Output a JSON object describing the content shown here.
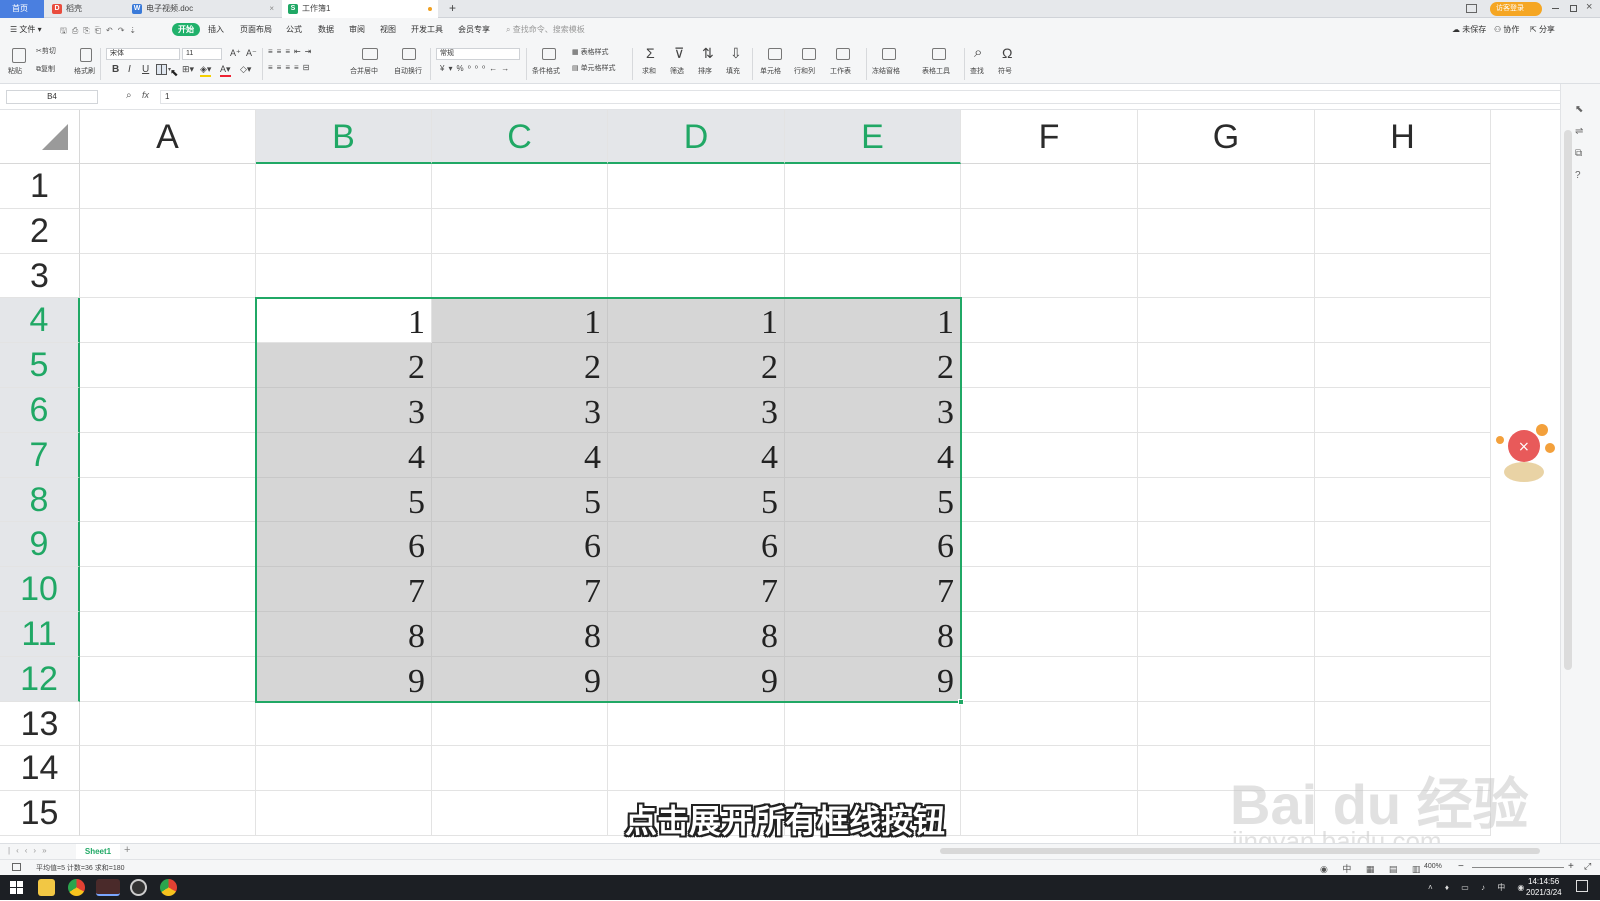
{
  "tabs": [
    {
      "label": "首页",
      "active": true
    },
    {
      "label": "稻壳"
    },
    {
      "label": "电子视频.doc"
    },
    {
      "label": "工作簿1"
    }
  ],
  "tabbar_right": {
    "login_label": "访客登录"
  },
  "menu": {
    "file": "文件",
    "items": [
      "开始",
      "插入",
      "页面布局",
      "公式",
      "数据",
      "审阅",
      "视图",
      "开发工具",
      "会员专享"
    ],
    "search_placeholder": "查找命令、搜索模板",
    "right": [
      "未保存",
      "协作",
      "分享"
    ]
  },
  "ribbon": {
    "paste": "粘贴",
    "cut": "剪切",
    "copy": "复制",
    "format_painter": "格式刷",
    "font_name": "宋体",
    "font_size": "11",
    "bold": "B",
    "italic": "I",
    "underline": "U",
    "merge": "合并居中",
    "wrap": "自动换行",
    "number_format": "常规",
    "cond_format": "条件格式",
    "table_style": "表格样式",
    "cell_style": "单元格样式",
    "sum": "求和",
    "filter": "筛选",
    "sort": "排序",
    "fill": "填充",
    "cell": "单元格",
    "rowcol": "行和列",
    "sheet": "工作表",
    "freeze": "冻结窗格",
    "table_tools": "表格工具",
    "find": "查找",
    "symbol": "符号"
  },
  "formula_bar": {
    "cell_ref": "B4",
    "fx": "fx",
    "value": "1"
  },
  "columns": [
    "A",
    "B",
    "C",
    "D",
    "E",
    "F",
    "G",
    "H"
  ],
  "rows": [
    "1",
    "2",
    "3",
    "4",
    "5",
    "6",
    "7",
    "8",
    "9",
    "10",
    "11",
    "12",
    "13",
    "14",
    "15"
  ],
  "cells": {
    "B4": "1",
    "C4": "1",
    "D4": "1",
    "E4": "1",
    "B5": "2",
    "C5": "2",
    "D5": "2",
    "E5": "2",
    "B6": "3",
    "C6": "3",
    "D6": "3",
    "E6": "3",
    "B7": "4",
    "C7": "4",
    "D7": "4",
    "E7": "4",
    "B8": "5",
    "C8": "5",
    "D8": "5",
    "E8": "5",
    "B9": "6",
    "C9": "6",
    "D9": "6",
    "E9": "6",
    "B10": "7",
    "C10": "7",
    "D10": "7",
    "E10": "7",
    "B11": "8",
    "C11": "8",
    "D11": "8",
    "E11": "8",
    "B12": "9",
    "C12": "9",
    "D12": "9",
    "E12": "9"
  },
  "selection": {
    "range": "B4:E12",
    "active": "B4",
    "color": "#20a865"
  },
  "sheet_tab": "Sheet1",
  "status": {
    "stats": "平均值=5  计数=36  求和=180",
    "zoom": "400%"
  },
  "taskbar": {
    "time": "14:14:56",
    "date": "2021/3/24"
  },
  "subtitle": "点击展开所有框线按钮",
  "watermark": {
    "line1": "Bai  du 经验",
    "line2": "jingyan.baidu.com"
  }
}
